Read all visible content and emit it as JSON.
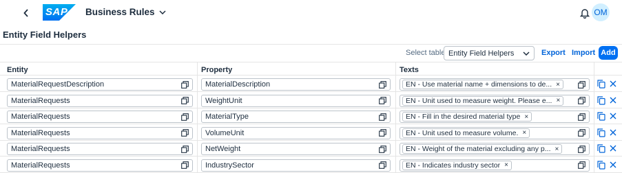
{
  "shell": {
    "back_icon": "chevron-left-icon",
    "logo_text": "SAP",
    "app_title": "Business Rules",
    "notification_icon": "bell-icon",
    "avatar_initials": "OM"
  },
  "page": {
    "title": "Entity Field Helpers"
  },
  "toolbar": {
    "select_label": "Select table",
    "select_value": "Entity Field Helpers",
    "export_label": "Export",
    "import_label": "Import",
    "add_label": "Add"
  },
  "table": {
    "columns": [
      "Entity",
      "Property",
      "Texts"
    ],
    "rows": [
      {
        "entity": "MaterialRequestDescription",
        "property": "MaterialDescription",
        "text": "EN - Use material name + dimensions to de..."
      },
      {
        "entity": "MaterialRequests",
        "property": "WeightUnit",
        "text": "EN - Unit used to measure weight. Please e..."
      },
      {
        "entity": "MaterialRequests",
        "property": "MaterialType",
        "text": "EN - Fill in the desired material type"
      },
      {
        "entity": "MaterialRequests",
        "property": "VolumeUnit",
        "text": "EN - Unit used to measure volume."
      },
      {
        "entity": "MaterialRequests",
        "property": "NetWeight",
        "text": "EN - Weight of the material excluding any p..."
      },
      {
        "entity": "MaterialRequests",
        "property": "IndustrySector",
        "text": "EN - Indicates industry sector"
      }
    ],
    "token_remove_glyph": "×",
    "row_copy_icon": "copy-icon",
    "row_delete_icon": "delete-x-icon",
    "value_help_icon": "value-help-icon"
  },
  "colors": {
    "accent": "#0070f2",
    "link": "#0064d9",
    "text": "#1d2d3e",
    "border": "#bcc3ca"
  }
}
